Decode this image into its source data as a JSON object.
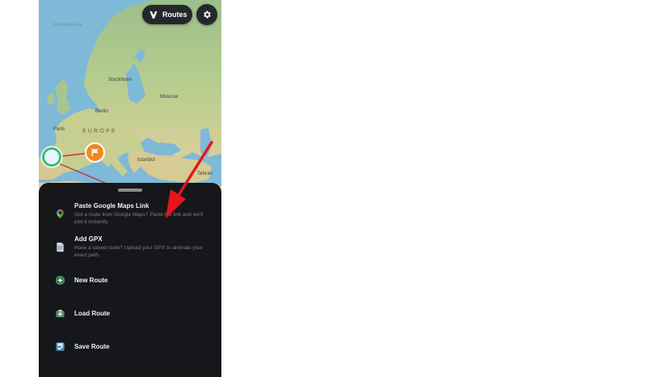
{
  "header": {
    "routes_label": "Routes",
    "routes_icon": "route-logo-icon",
    "settings_icon": "gear-icon"
  },
  "map": {
    "labels": {
      "stockholm": "Stockholm",
      "moscow": "Moscow",
      "berlin": "Berlin",
      "paris": "Paris",
      "europe": "EUROPE",
      "istanbul": "Istanbul",
      "tehran": "Tehran",
      "norwegian_sea": "Norwegian Sea"
    }
  },
  "menu": {
    "items": [
      {
        "title": "Paste Google Maps Link",
        "desc": "Got a route from Google Maps? Paste the link and we'll plot it instantly.",
        "icon": "map-pin-icon"
      },
      {
        "title": "Add GPX",
        "desc": "Have a saved route? Upload your GPX to animate your exact path.",
        "icon": "document-icon"
      },
      {
        "title": "New Route",
        "icon": "plus-circle-icon"
      },
      {
        "title": "Load Route",
        "icon": "folder-icon"
      },
      {
        "title": "Save Route",
        "icon": "save-icon"
      }
    ]
  },
  "colors": {
    "sheet_bg": "#16171a",
    "accent_orange": "#f28a1d",
    "arrow_red": "#e8141b",
    "route_red": "#c8323a",
    "start_green": "#3dbb7a"
  }
}
